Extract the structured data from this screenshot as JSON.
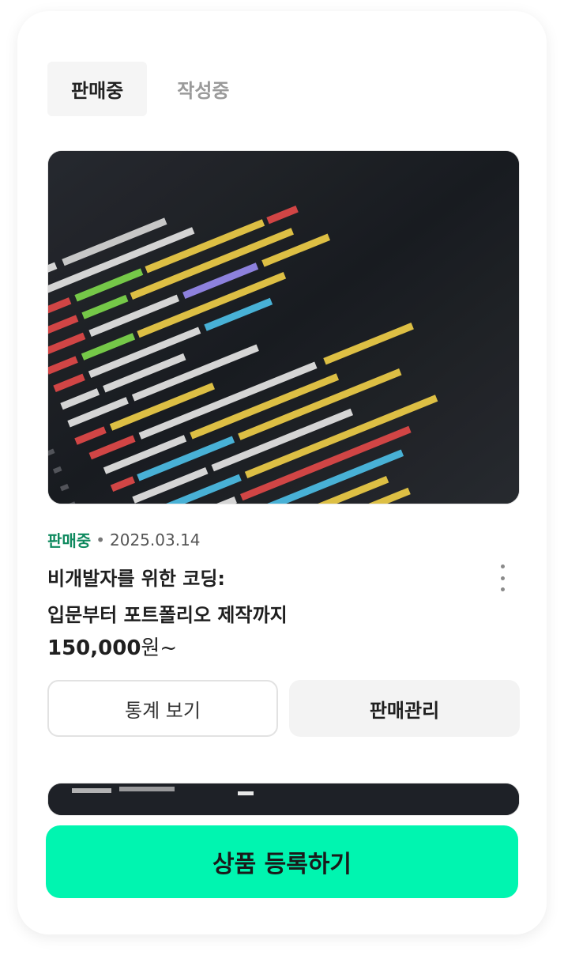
{
  "tabs": [
    {
      "label": "판매중",
      "active": true
    },
    {
      "label": "작성중",
      "active": false
    }
  ],
  "product": {
    "status": "판매중",
    "date": "2025.03.14",
    "title_line1": "비개발자를 위한 코딩:",
    "title_line2": "입문부터 포트폴리오 제작까지",
    "price_number": "150,000",
    "price_unit": "원~",
    "thumbnail_icon": "code-screen-image",
    "stats_button": "통계 보기",
    "manage_button": "판매관리"
  },
  "cta_label": "상품 등록하기",
  "colors": {
    "accent": "#00f5b0",
    "status_green": "#0f8a5f"
  }
}
